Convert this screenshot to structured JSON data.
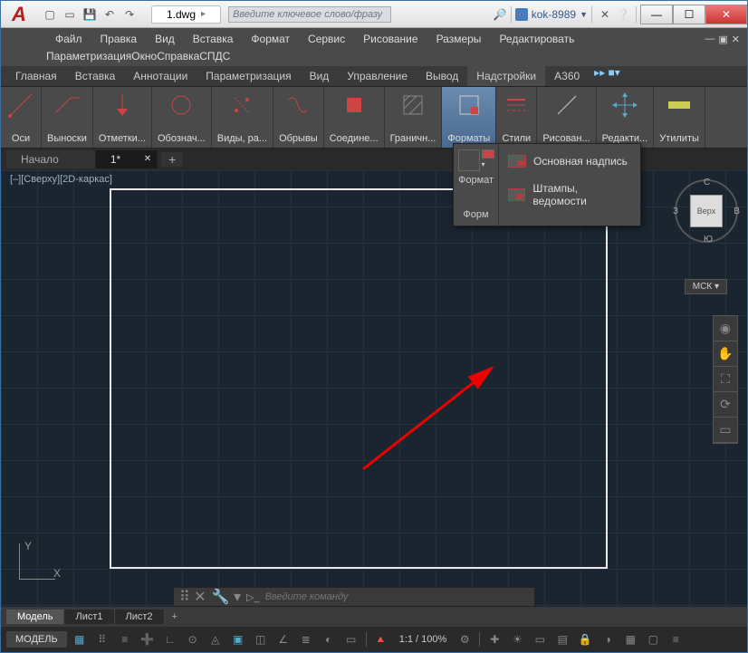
{
  "title": "1.dwg",
  "search_placeholder": "Введите ключевое слово/фразу",
  "user": "kok-8989",
  "menu1": [
    "Файл",
    "Правка",
    "Вид",
    "Вставка",
    "Формат",
    "Сервис",
    "Рисование",
    "Размеры",
    "Редактировать"
  ],
  "menu2": [
    "Параметризация",
    "Окно",
    "Справка",
    "СПДС"
  ],
  "ribbon_tabs": [
    "Главная",
    "Вставка",
    "Аннотации",
    "Параметризация",
    "Вид",
    "Управление",
    "Вывод",
    "Надстройки",
    "A360"
  ],
  "ribbon_panels": [
    "Оси",
    "Выноски",
    "Отметки...",
    "Обознач...",
    "Виды, ра...",
    "Обрывы",
    "Соедине...",
    "Граничн...",
    "Форматы",
    "Стили",
    "Рисован...",
    "Редакти...",
    "Утилиты"
  ],
  "ribbon_active": 8,
  "dropdown": {
    "left_label": "Формат",
    "left_sub": "Форм",
    "items": [
      "Основная надпись",
      "Штампы, ведомости"
    ]
  },
  "doc_tabs": [
    "Начало",
    "1*"
  ],
  "doc_active": 1,
  "viewport_label": "[–][Сверху][2D-каркас]",
  "viewcube": {
    "face": "Верх",
    "n": "С",
    "s": "Ю",
    "e": "В",
    "w": "З"
  },
  "msk": "МСК",
  "layout_tabs": [
    "Модель",
    "Лист1",
    "Лист2"
  ],
  "layout_active": 0,
  "cmd_placeholder": "Введите команду",
  "status": {
    "model": "МОДЕЛЬ",
    "scale": "1:1 / 100%"
  }
}
